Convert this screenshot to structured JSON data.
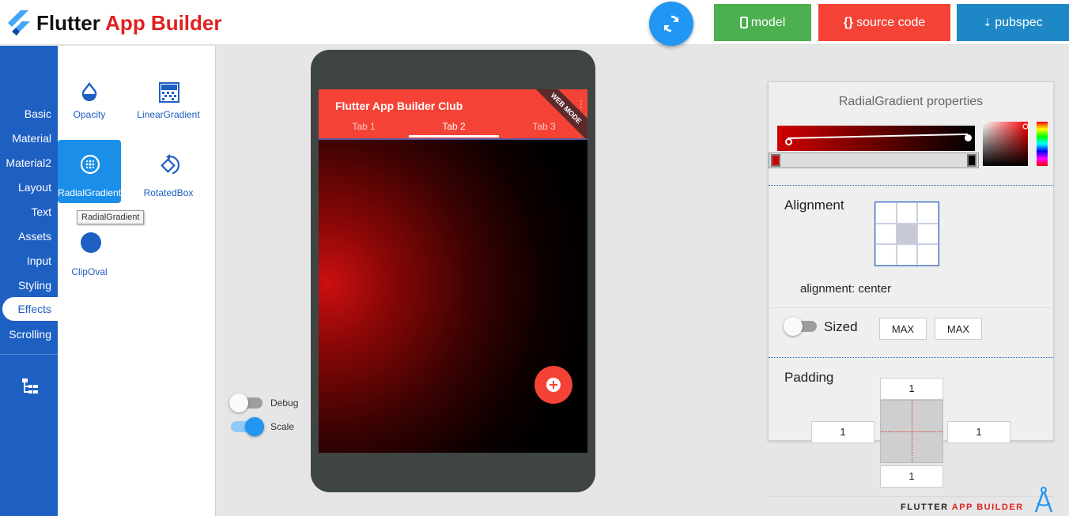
{
  "header": {
    "title_part1": "Flutter",
    "title_part2": "App Builder",
    "buttons": {
      "model": "model",
      "source_code": "source code",
      "pubspec": "pubspec"
    }
  },
  "sidebar": {
    "categories": [
      "Basic",
      "Material",
      "Material2",
      "Layout",
      "Text",
      "Assets",
      "Input",
      "Styling",
      "Effects",
      "Scrolling"
    ],
    "active": "Effects"
  },
  "widgets": {
    "items": [
      "Opacity",
      "LinearGradient",
      "RadialGradient",
      "RotatedBox",
      "ClipOval"
    ],
    "selected": "RadialGradient",
    "tooltip": "RadialGradient"
  },
  "phone": {
    "app_title": "Flutter App Builder Club",
    "tabs": [
      "Tab 1",
      "Tab 2",
      "Tab 3"
    ],
    "active_tab": "Tab 2",
    "banner": "WEB MODE"
  },
  "toggles": {
    "debug": {
      "label": "Debug",
      "on": false
    },
    "scale": {
      "label": "Scale",
      "on": true
    }
  },
  "properties": {
    "title": "RadialGradient properties",
    "gradient_colors": [
      "#d00000",
      "#000000"
    ],
    "alignment_label": "Alignment",
    "alignment_value": "alignment: center",
    "sized_label": "Sized",
    "sized_width": "MAX",
    "sized_height": "MAX",
    "padding_label": "Padding",
    "padding": {
      "top": "1",
      "left": "1",
      "right": "1",
      "bottom": "1"
    }
  },
  "footer": {
    "brand_part1": "FLUTTER",
    "brand_part2": "APP BUILDER"
  },
  "colors": {
    "accent": "#2196f3",
    "sidebar": "#1e5fc2",
    "model_button": "#4caf50",
    "source_button": "#f44336",
    "pubspec_button": "#1e88c7",
    "appbar": "#f44336"
  }
}
